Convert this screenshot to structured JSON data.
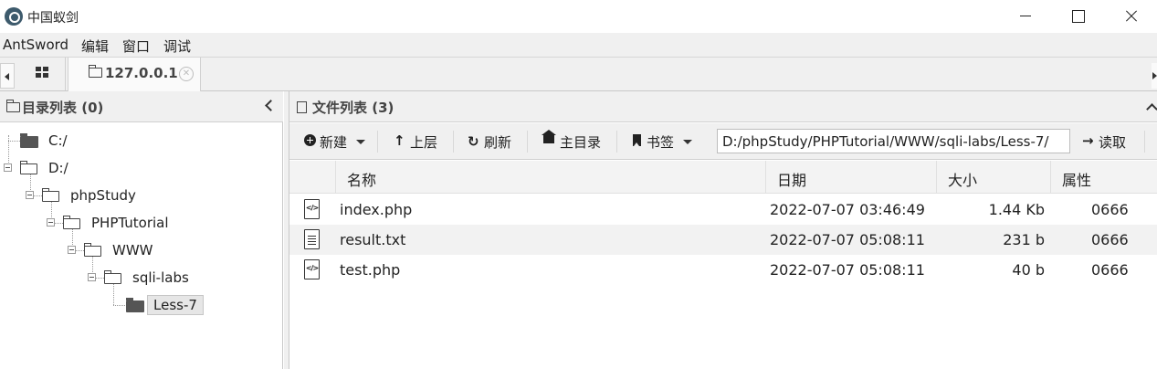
{
  "window": {
    "title": "中国蚁剑"
  },
  "menu": {
    "items": [
      "AntSword",
      "编辑",
      "窗口",
      "调试"
    ]
  },
  "tabs": {
    "host_label": "127.0.0.1"
  },
  "dir_panel": {
    "title": "目录列表 (0)",
    "tree": {
      "c_drive": "C:/",
      "d_drive": "D:/",
      "phpstudy": "phpStudy",
      "phptutorial": "PHPTutorial",
      "www": "WWW",
      "sqli_labs": "sqli-labs",
      "less7": "Less-7"
    }
  },
  "file_panel": {
    "title": "文件列表 (3)",
    "toolbar": {
      "new_label": "新建",
      "up_label": "上层",
      "refresh_label": "刷新",
      "home_label": "主目录",
      "bookmark_label": "书签",
      "path_value": "D:/phpStudy/PHPTutorial/WWW/sqli-labs/Less-7/",
      "read_label": "读取"
    },
    "columns": {
      "name": "名称",
      "date": "日期",
      "size": "大小",
      "attr": "属性"
    },
    "rows": [
      {
        "icon": "code-file-icon",
        "name": "index.php",
        "date": "2022-07-07 03:46:49",
        "size": "1.44 Kb",
        "attr": "0666"
      },
      {
        "icon": "text-file-icon",
        "name": "result.txt",
        "date": "2022-07-07 05:08:11",
        "size": "231 b",
        "attr": "0666"
      },
      {
        "icon": "code-file-icon",
        "name": "test.php",
        "date": "2022-07-07 05:08:11",
        "size": "40 b",
        "attr": "0666"
      }
    ]
  }
}
